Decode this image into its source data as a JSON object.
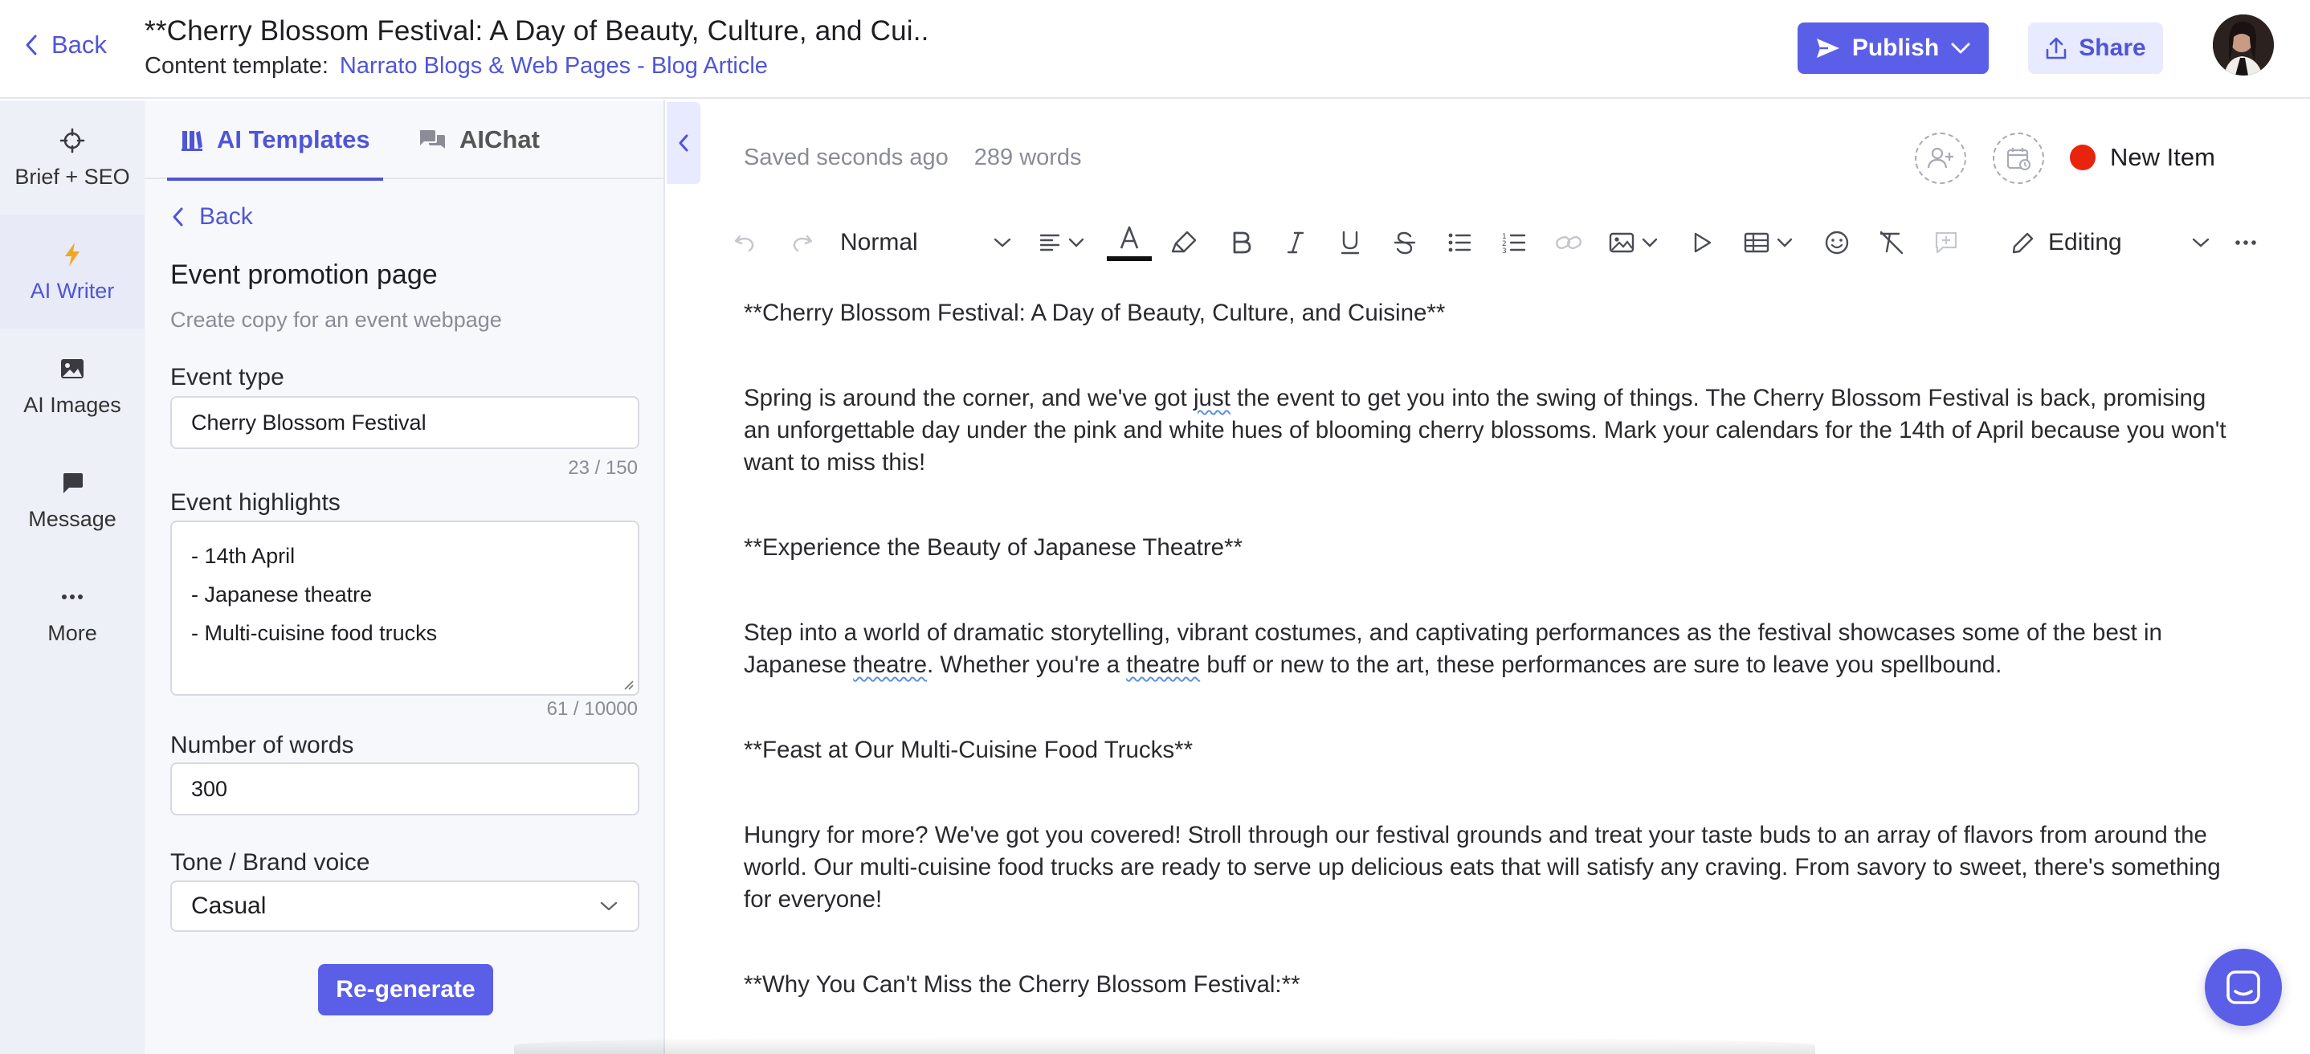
{
  "header": {
    "back_label": "Back",
    "doc_title": "**Cherry Blossom Festival: A Day of Beauty, Culture, and Cui..",
    "template_prefix": "Content template:",
    "template_link": "Narrato Blogs & Web Pages - Blog Article",
    "publish_label": "Publish",
    "share_label": "Share"
  },
  "leftnav": {
    "items": [
      {
        "label": "Brief + SEO",
        "icon": "crosshair-icon"
      },
      {
        "label": "AI Writer",
        "icon": "lightning-icon"
      },
      {
        "label": "AI Images",
        "icon": "image-icon"
      },
      {
        "label": "Message",
        "icon": "chat-icon"
      },
      {
        "label": "More",
        "icon": "ellipsis-icon"
      }
    ],
    "active": "AI Writer"
  },
  "panel": {
    "tabs": [
      {
        "label": "AI Templates",
        "icon": "templates-icon",
        "active": true
      },
      {
        "label": "AIChat",
        "icon": "chat-bubbles-icon",
        "active": false
      }
    ],
    "back_label": "Back",
    "title": "Event promotion page",
    "subtitle": "Create copy for an event webpage",
    "event_type": {
      "label": "Event type",
      "value": "Cherry Blossom Festival",
      "count": "23 / 150"
    },
    "event_highlights": {
      "label": "Event highlights",
      "lines": [
        "- 14th April",
        "- Japanese theatre",
        "- Multi-cuisine food trucks"
      ],
      "count": "61 / 10000"
    },
    "num_words": {
      "label": "Number of words",
      "value": "300"
    },
    "tone": {
      "label": "Tone / Brand voice",
      "value": "Casual"
    },
    "regenerate_label": "Re-generate"
  },
  "editor": {
    "saved_status": "Saved seconds ago",
    "word_count": "289 words",
    "status_label": "New Item",
    "status_color": "#e8240c",
    "toolbar": {
      "paragraph_style": "Normal",
      "mode": "Editing"
    },
    "paragraphs": [
      "**Cherry Blossom Festival: A Day of Beauty, Culture, and Cuisine**",
      "Spring is around the corner, and we've got just the event to get you into the swing of things. The Cherry Blossom Festival is back, promising an unforgettable day under the pink and white hues of blooming cherry blossoms. Mark your calendars for the 14th of April because you won't want to miss this!",
      "**Experience the Beauty of Japanese Theatre**",
      "Step into a world of dramatic storytelling, vibrant costumes, and captivating performances as the festival showcases some of the best in Japanese theatre. Whether you're a theatre buff or new to the art, these performances are sure to leave you spellbound.",
      "**Feast at Our Multi-Cuisine Food Trucks**",
      "Hungry for more? We've got you covered! Stroll through our festival grounds and treat your taste buds to an array of flavors from around the world. Our multi-cuisine food trucks are ready to serve up delicious eats that will satisfy any craving. From savory to sweet, there's something for everyone!",
      "**Why You Can't Miss the Cherry Blossom Festival:**"
    ]
  },
  "colors": {
    "accent": "#5b5fe8",
    "accent_text": "#4f55d6",
    "nav_bg": "#eef0f7"
  }
}
